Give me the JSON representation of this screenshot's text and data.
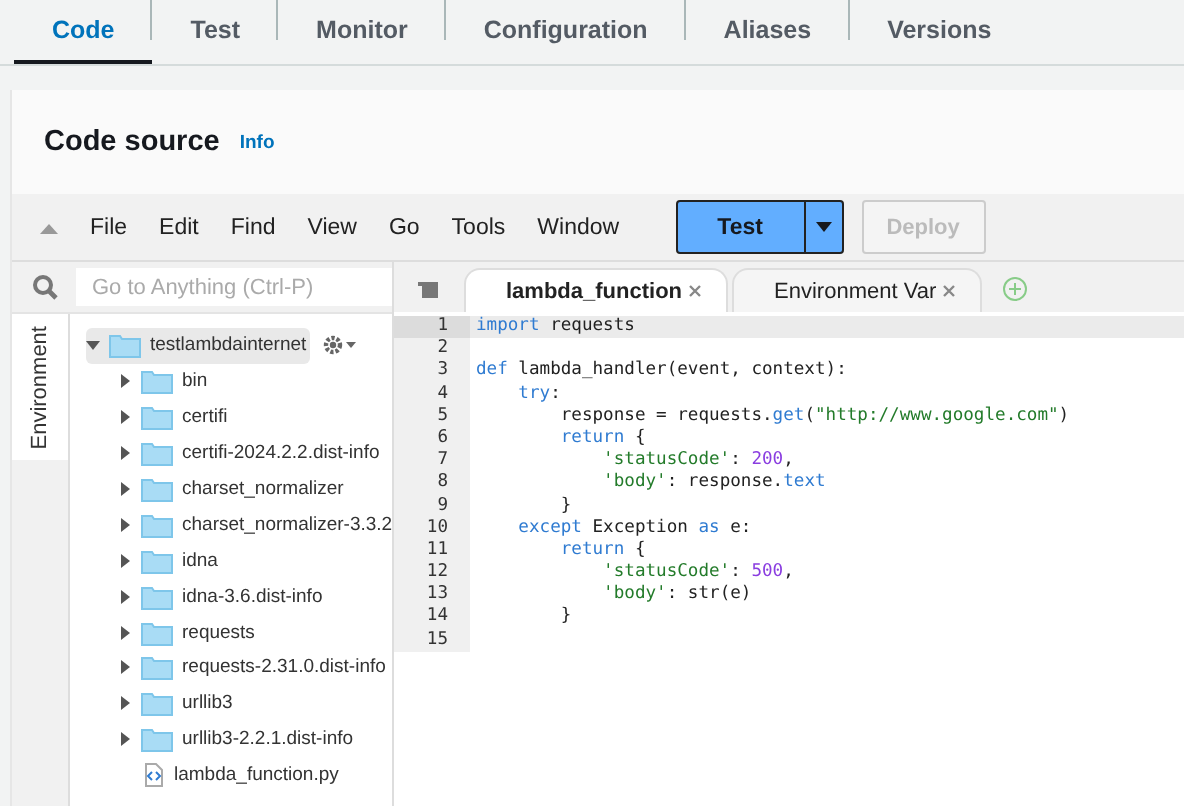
{
  "tabs": [
    {
      "label": "Code",
      "selected": true
    },
    {
      "label": "Test",
      "selected": false
    },
    {
      "label": "Monitor",
      "selected": false
    },
    {
      "label": "Configuration",
      "selected": false
    },
    {
      "label": "Aliases",
      "selected": false
    },
    {
      "label": "Versions",
      "selected": false
    }
  ],
  "panel": {
    "title": "Code source",
    "info_link": "Info"
  },
  "menu": [
    "File",
    "Edit",
    "Find",
    "View",
    "Go",
    "Tools",
    "Window"
  ],
  "test_button": "Test",
  "deploy_button": {
    "label": "Deploy",
    "disabled": true
  },
  "side_tab": "Environment",
  "search": {
    "placeholder": "Go to Anything (Ctrl-P)"
  },
  "tree": [
    {
      "name": "testlambdainternet",
      "kind": "folder",
      "expanded": true,
      "children": [
        {
          "name": "bin",
          "kind": "folder",
          "expanded": false
        },
        {
          "name": "certifi",
          "kind": "folder",
          "expanded": false
        },
        {
          "name": "certifi-2024.2.2.dist-info",
          "kind": "folder",
          "expanded": false
        },
        {
          "name": "charset_normalizer",
          "kind": "folder",
          "expanded": false
        },
        {
          "name": "charset_normalizer-3.3.2",
          "kind": "folder",
          "expanded": false
        },
        {
          "name": "idna",
          "kind": "folder",
          "expanded": false
        },
        {
          "name": "idna-3.6.dist-info",
          "kind": "folder",
          "expanded": false
        },
        {
          "name": "requests",
          "kind": "folder",
          "expanded": false
        },
        {
          "name": "requests-2.31.0.dist-info",
          "kind": "folder",
          "expanded": false
        },
        {
          "name": "urllib3",
          "kind": "folder",
          "expanded": false
        },
        {
          "name": "urllib3-2.2.1.dist-info",
          "kind": "folder",
          "expanded": false
        },
        {
          "name": "lambda_function.py",
          "kind": "file"
        }
      ]
    }
  ],
  "editor_tabs": [
    {
      "label": "lambda_function",
      "selected": true
    },
    {
      "label": "Environment Var",
      "selected": false
    }
  ],
  "code": [
    {
      "number": "1",
      "current": true,
      "tokens": [
        {
          "text": "import",
          "kind": "keyword"
        },
        {
          "text": " requests",
          "kind": "plain"
        }
      ]
    },
    {
      "number": "2",
      "current": false
    },
    {
      "number": "3",
      "current": false,
      "tokens": [
        {
          "text": "def",
          "kind": "keyword"
        },
        {
          "text": " lambda_handler(event, context):",
          "kind": "plain"
        }
      ]
    },
    {
      "number": "4",
      "current": false,
      "tokens": [
        {
          "text": "    try",
          "kind": "keyword"
        },
        {
          "text": ":",
          "kind": "plain"
        }
      ]
    },
    {
      "number": "5",
      "current": false,
      "tokens": [
        {
          "text": "        response = requests.",
          "kind": "plain"
        },
        {
          "text": "get",
          "kind": "builtin"
        },
        {
          "text": "(",
          "kind": "plain"
        },
        {
          "text": "\"http://www.google.com\"",
          "kind": "string"
        },
        {
          "text": ")",
          "kind": "plain"
        }
      ]
    },
    {
      "number": "6",
      "current": false,
      "tokens": [
        {
          "text": "        return",
          "kind": "keyword"
        },
        {
          "text": " {",
          "kind": "plain"
        }
      ]
    },
    {
      "number": "7",
      "current": false,
      "tokens": [
        {
          "text": "            'statusCode'",
          "kind": "string"
        },
        {
          "text": ": ",
          "kind": "plain"
        },
        {
          "text": "200",
          "kind": "number"
        },
        {
          "text": ",",
          "kind": "plain"
        }
      ]
    },
    {
      "number": "8",
      "current": false,
      "tokens": [
        {
          "text": "            'body'",
          "kind": "string"
        },
        {
          "text": ": response.",
          "kind": "plain"
        },
        {
          "text": "text",
          "kind": "builtin"
        }
      ]
    },
    {
      "number": "9",
      "current": false,
      "tokens": [
        {
          "text": "        }",
          "kind": "plain"
        }
      ]
    },
    {
      "number": "10",
      "current": false,
      "tokens": [
        {
          "text": "    except",
          "kind": "keyword"
        },
        {
          "text": " Exception ",
          "kind": "plain"
        },
        {
          "text": "as",
          "kind": "keyword"
        },
        {
          "text": " e:",
          "kind": "plain"
        }
      ]
    },
    {
      "number": "11",
      "current": false,
      "tokens": [
        {
          "text": "        return",
          "kind": "keyword"
        },
        {
          "text": " {",
          "kind": "plain"
        }
      ]
    },
    {
      "number": "12",
      "current": false,
      "tokens": [
        {
          "text": "            'statusCode'",
          "kind": "string"
        },
        {
          "text": ": ",
          "kind": "plain"
        },
        {
          "text": "500",
          "kind": "number"
        },
        {
          "text": ",",
          "kind": "plain"
        }
      ]
    },
    {
      "number": "13",
      "current": false,
      "tokens": [
        {
          "text": "            'body'",
          "kind": "string"
        },
        {
          "text": ": str(e)",
          "kind": "plain"
        }
      ]
    },
    {
      "number": "14",
      "current": false,
      "tokens": [
        {
          "text": "        }",
          "kind": "plain"
        }
      ]
    },
    {
      "number": "15",
      "current": false
    }
  ]
}
